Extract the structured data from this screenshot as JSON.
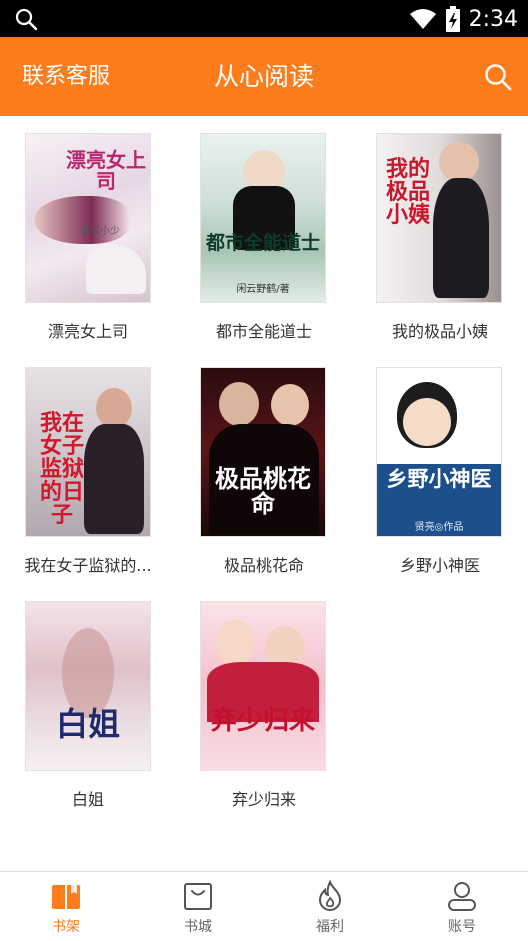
{
  "status_bar": {
    "time": "2:34"
  },
  "header": {
    "contact_label": "联系客服",
    "title": "从心阅读"
  },
  "books": [
    {
      "title": "漂亮女上司",
      "cover_text": "漂亮女上司",
      "cover_sub": "请风小少"
    },
    {
      "title": "都市全能道士",
      "cover_text": "都市全能道士",
      "cover_sub": "闲云野鹤/著"
    },
    {
      "title": "我的极品小姨",
      "cover_text": "我的极品小姨",
      "cover_sub": ""
    },
    {
      "title": "我在女子监狱的...",
      "cover_text": "我在女子监狱的日子",
      "cover_sub": ""
    },
    {
      "title": "极品桃花命",
      "cover_text": "极品桃花命",
      "cover_sub": ""
    },
    {
      "title": "乡野小神医",
      "cover_text": "乡野小神医",
      "cover_sub": "贤亮◎作品"
    },
    {
      "title": "白姐",
      "cover_text": "白姐",
      "cover_sub": ""
    },
    {
      "title": "弃少归来",
      "cover_text": "弃少归来",
      "cover_sub": ""
    }
  ],
  "tabs": [
    {
      "label": "书架",
      "icon": "bookshelf-icon",
      "active": true
    },
    {
      "label": "书城",
      "icon": "store-bag-icon",
      "active": false
    },
    {
      "label": "福利",
      "icon": "flame-icon",
      "active": false
    },
    {
      "label": "账号",
      "icon": "user-icon",
      "active": false
    }
  ],
  "colors": {
    "accent": "#fd7c1c",
    "status_bar": "#000000",
    "tab_inactive": "#666666"
  }
}
